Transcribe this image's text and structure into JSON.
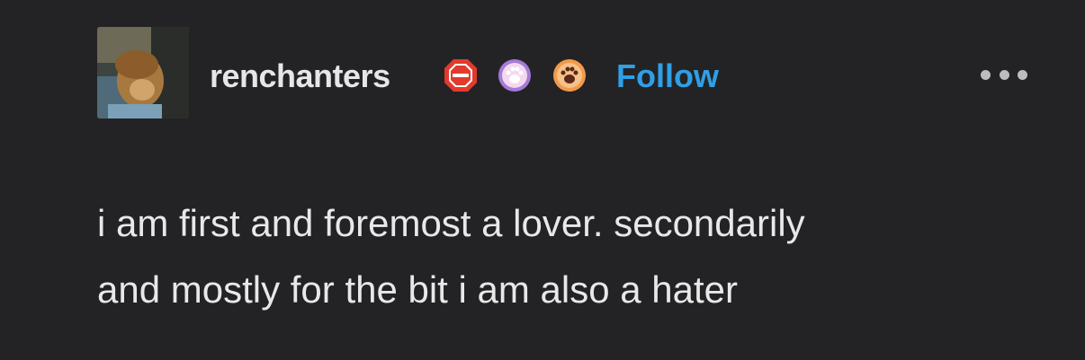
{
  "post": {
    "username": "renchanters",
    "follow_label": "Follow",
    "body_lines": [
      "i am first and foremost a lover. secondarily",
      "and mostly for the bit i am also a hater"
    ]
  },
  "icons": {
    "avatar": "profile-photo",
    "badge_1": "red-octagon-badge",
    "badge_2": "purple-paw-badge",
    "badge_3": "orange-paw-badge",
    "more": "ellipsis-icon"
  },
  "colors": {
    "background": "#232326",
    "username": "#e6e6e6",
    "follow": "#2f9fe6",
    "body_text": "#e8e8e8"
  }
}
